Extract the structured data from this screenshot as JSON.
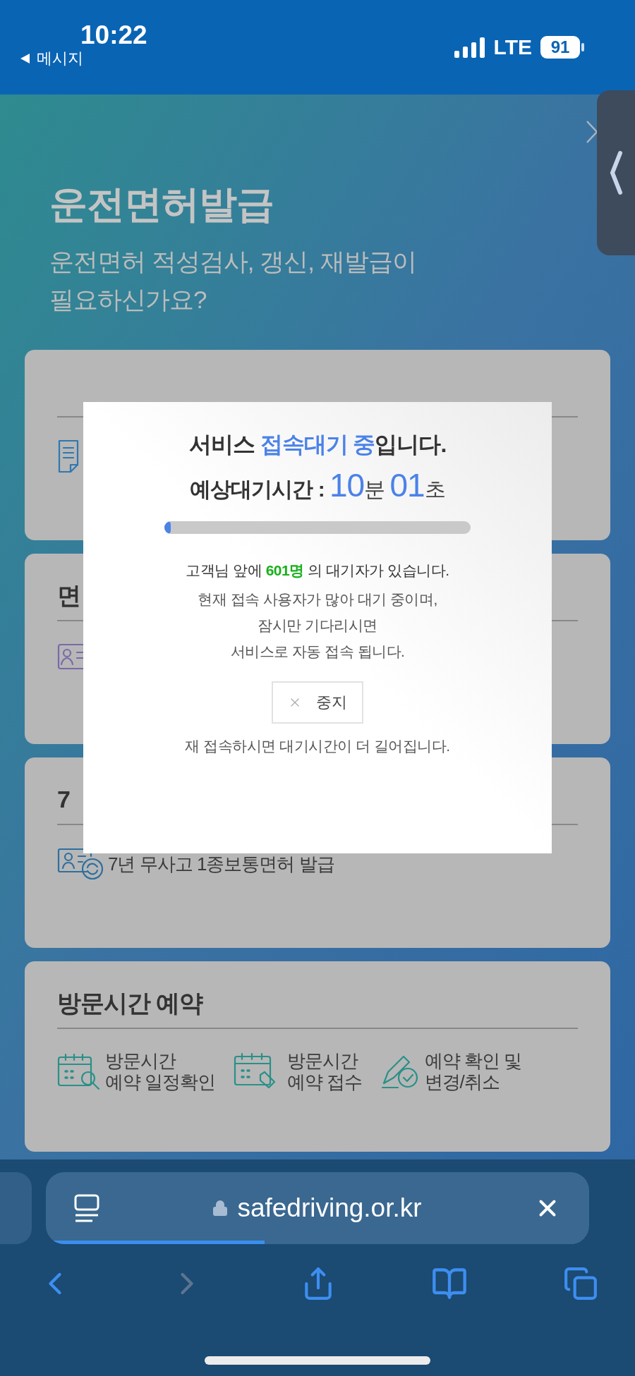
{
  "status_bar": {
    "time": "10:22",
    "back_label": "메시지",
    "network": "LTE",
    "battery": "91"
  },
  "header": {
    "title": "운전면허발급",
    "subtitle_lines": [
      "운전면허 적성검사, 갱신, 재발급이",
      "필요하신가요?"
    ]
  },
  "cards": [
    {
      "items": [
        {
          "kind": "document"
        }
      ]
    },
    {
      "title": "면",
      "items": [
        {
          "kind": "card"
        }
      ]
    },
    {
      "title": "7",
      "items": [
        {
          "kind": "renew",
          "lines": [
            "7년 무사고 1종보통면허 발급"
          ]
        }
      ]
    },
    {
      "title": "방문시간 예약",
      "items": [
        {
          "kind": "search",
          "lines": [
            "방문시간",
            "예약 일정확인"
          ]
        },
        {
          "kind": "apply",
          "lines": [
            "방문시간",
            "예약 접수"
          ]
        },
        {
          "kind": "edit",
          "lines": [
            "예약 확인 및",
            "변경/취소"
          ]
        }
      ]
    }
  ],
  "modal": {
    "heading": [
      {
        "text": "서비스 ",
        "kind": "plain"
      },
      {
        "text": "접속대기 중",
        "kind": "accent"
      },
      {
        "text": "입니다.",
        "kind": "plain"
      }
    ],
    "wait_time": [
      {
        "text": "예상대기시간 : ",
        "kind": "label"
      },
      {
        "text": "10",
        "kind": "number"
      },
      {
        "text": "분 ",
        "kind": "unit"
      },
      {
        "text": "01",
        "kind": "number"
      },
      {
        "text": "초",
        "kind": "unit"
      }
    ],
    "progress": {
      "level": 0.02
    },
    "queue": [
      {
        "text": "고객님 앞에 ",
        "kind": "plain"
      },
      {
        "text": "601명",
        "kind": "count"
      },
      {
        "text": " 의 대기자가 있습니다.",
        "kind": "plain"
      }
    ],
    "message_lines": [
      "현재 접속 사용자가 많아 대기 중이며,",
      "잠시만 기다리시면",
      "서비스로 자동 접속 됩니다."
    ],
    "stop_button": "중지",
    "note": "재 접속하시면 대기시간이 더 길어집니다."
  },
  "browser": {
    "url": "safedriving.or.kr",
    "loading": {
      "level": 0.4
    },
    "back_disabled": false,
    "forward_disabled": true
  }
}
